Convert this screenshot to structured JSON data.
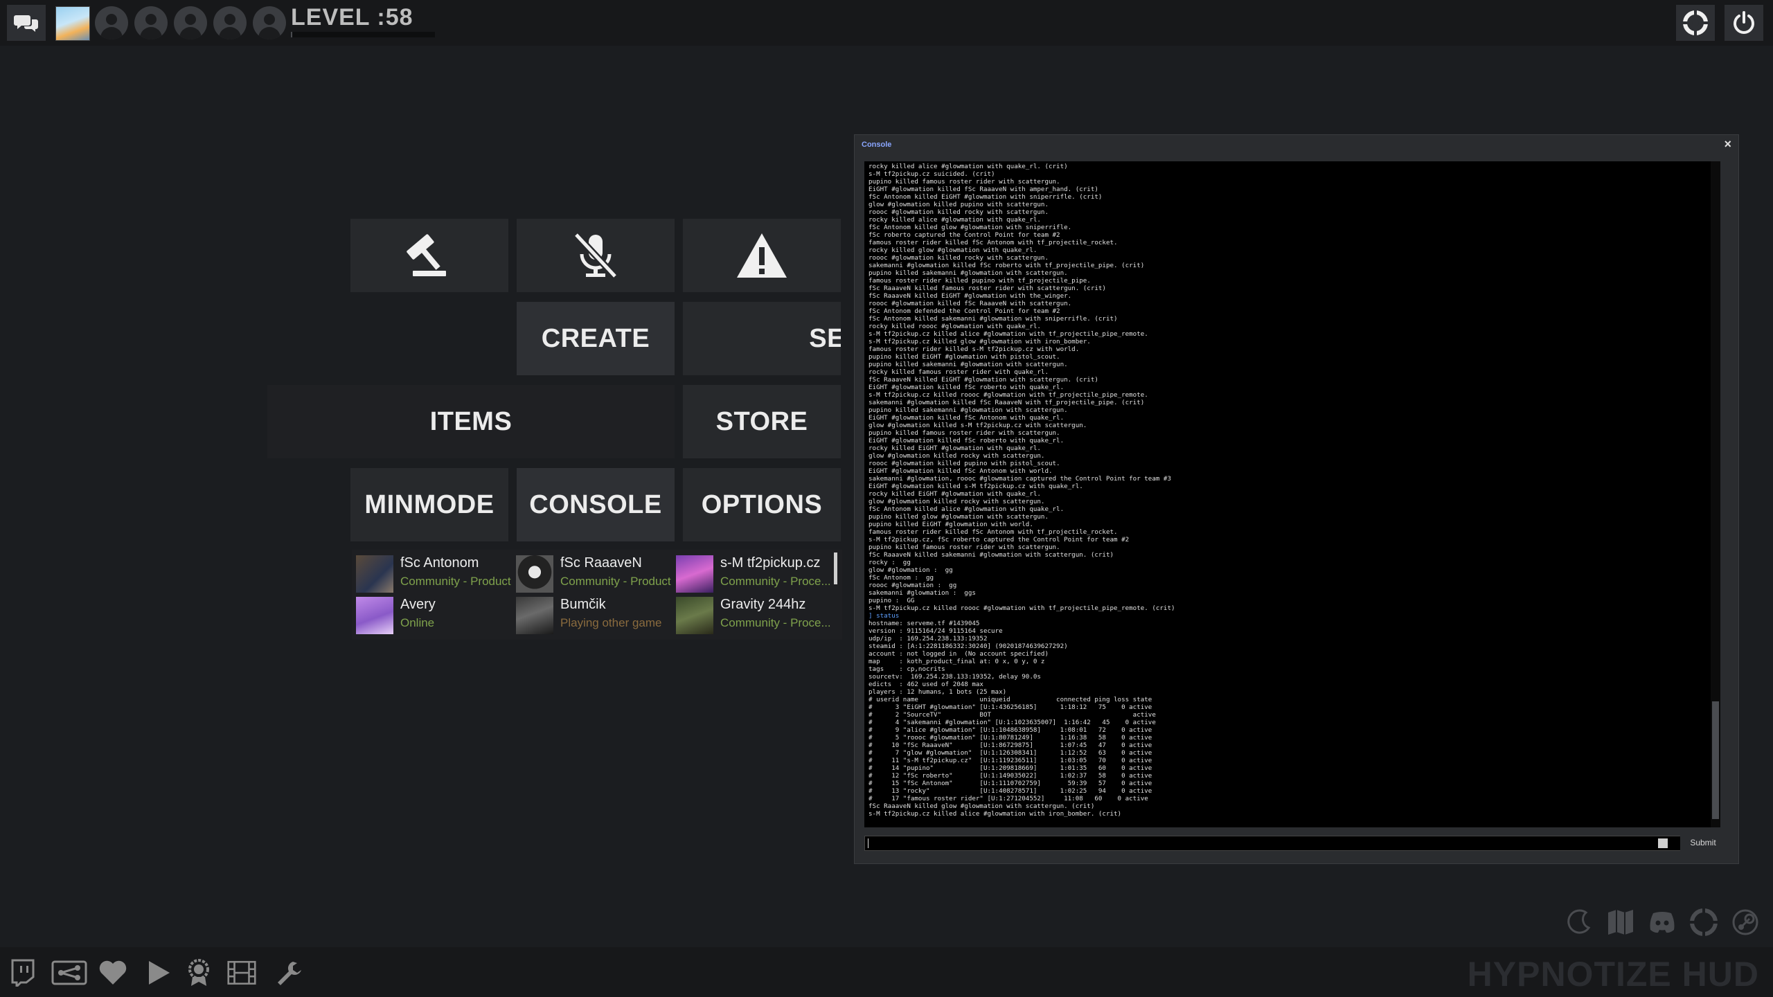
{
  "top_bar": {
    "level_label": "LEVEL :58",
    "level_progress": 0.01,
    "party_slot_count": 5
  },
  "menu": {
    "create_label": "CREATE",
    "server_partial_label": "SE",
    "items_label": "ITEMS",
    "store_label": "STORE",
    "minmode_label": "MINMODE",
    "console_label": "CONSOLE",
    "options_label": "OPTIONS"
  },
  "friends": [
    {
      "name": "fSc Antonom",
      "status": "Community - Product",
      "status_type": "game"
    },
    {
      "name": "fSc RaaaveN",
      "status": "Community - Product",
      "status_type": "game"
    },
    {
      "name": "s-M tf2pickup.cz",
      "status": "Community - Proce...",
      "status_type": "game"
    },
    {
      "name": "Avery",
      "status": "Online",
      "status_type": "online"
    },
    {
      "name": "Bumčik",
      "status": "Playing other game",
      "status_type": "other"
    },
    {
      "name": "Gravity 244hz",
      "status": "Community - Proce...",
      "status_type": "game"
    }
  ],
  "console": {
    "title": "Console",
    "close_glyph": "×",
    "submit_label": "Submit",
    "input_value": "",
    "lines": [
      "rocky killed alice #glowmation with quake_rl. (crit)",
      "s-M tf2pickup.cz suicided. (crit)",
      "pupino killed famous roster rider with scattergun.",
      "EiGHT #glowmation killed fSc RaaaveN with amper_hand. (crit)",
      "fSc Antonom killed EiGHT #glowmation with sniperrifle. (crit)",
      "glow #glowmation killed pupino with scattergun.",
      "roooc #glowmation killed rocky with scattergun.",
      "rocky killed alice #glowmation with quake_rl.",
      "fSc Antonom killed glow #glowmation with sniperrifle.",
      "fSc roberto captured the Control Point for team #2",
      "famous roster rider killed fSc Antonom with tf_projectile_rocket.",
      "rocky killed glow #glowmation with quake_rl.",
      "roooc #glowmation killed rocky with scattergun.",
      "sakemanni #glowmation killed fSc roberto with tf_projectile_pipe. (crit)",
      "pupino killed sakemanni #glowmation with scattergun.",
      "famous roster rider killed pupino with tf_projectile_pipe.",
      "fSc RaaaveN killed famous roster rider with scattergun. (crit)",
      "fSc RaaaveN killed EiGHT #glowmation with the_winger.",
      "roooc #glowmation killed fSc RaaaveN with scattergun.",
      "fSc Antonom defended the Control Point for team #2",
      "fSc Antonom killed sakemanni #glowmation with sniperrifle. (crit)",
      "rocky killed roooc #glowmation with quake_rl.",
      "s-M tf2pickup.cz killed alice #glowmation with tf_projectile_pipe_remote.",
      "s-M tf2pickup.cz killed glow #glowmation with iron_bomber.",
      "famous roster rider killed s-M tf2pickup.cz with world.",
      "pupino killed EiGHT #glowmation with pistol_scout.",
      "pupino killed sakemanni #glowmation with scattergun.",
      "rocky killed famous roster rider with quake_rl.",
      "fSc RaaaveN killed EiGHT #glowmation with scattergun. (crit)",
      "EiGHT #glowmation killed fSc roberto with quake_rl.",
      "s-M tf2pickup.cz killed roooc #glowmation with tf_projectile_pipe_remote.",
      "sakemanni #glowmation killed fSc RaaaveN with tf_projectile_pipe. (crit)",
      "pupino killed sakemanni #glowmation with scattergun.",
      "EiGHT #glowmation killed fSc Antonom with quake_rl.",
      "glow #glowmation killed s-M tf2pickup.cz with scattergun.",
      "pupino killed famous roster rider with scattergun.",
      "EiGHT #glowmation killed fSc roberto with quake_rl.",
      "rocky killed EiGHT #glowmation with quake_rl.",
      "glow #glowmation killed rocky with scattergun.",
      "roooc #glowmation killed pupino with pistol_scout.",
      "EiGHT #glowmation killed fSc Antonom with world.",
      "sakemanni #glowmation, roooc #glowmation captured the Control Point for team #3",
      "EiGHT #glowmation killed s-M tf2pickup.cz with quake_rl.",
      "rocky killed EiGHT #glowmation with quake_rl.",
      "glow #glowmation killed rocky with scattergun.",
      "fSc Antonom killed alice #glowmation with quake_rl.",
      "pupino killed glow #glowmation with scattergun.",
      "pupino killed EiGHT #glowmation with world.",
      "famous roster rider killed fSc Antonom with tf_projectile_rocket.",
      "s-M tf2pickup.cz, fSc roberto captured the Control Point for team #2",
      "pupino killed famous roster rider with scattergun.",
      "fSc RaaaveN killed sakemanni #glowmation with scattergun. (crit)",
      "rocky :  gg",
      "glow #glowmation :  gg",
      "fSc Antonom :  gg",
      "roooc #glowmation :  gg",
      "sakemanni #glowmation :  ggs",
      "pupino :  GG",
      "s-M tf2pickup.cz killed roooc #glowmation with tf_projectile_pipe_remote. (crit)",
      "] status",
      "hostname: serveme.tf #1439045",
      "version : 9115164/24 9115164 secure",
      "udp/ip  : 169.254.238.133:19352",
      "steamid : [A:1:2281186332:30240] (90201874639627292)",
      "account : not logged in  (No account specified)",
      "map     : koth_product_final at: 0 x, 0 y, 0 z",
      "tags    : cp,nocrits",
      "sourcetv:  169.254.238.133:19352, delay 90.0s",
      "edicts  : 462 used of 2048 max",
      "players : 12 humans, 1 bots (25 max)",
      "# userid name                uniqueid            connected ping loss state",
      "#      3 \"EiGHT #glowmation\" [U:1:436256185]      1:18:12   75    0 active",
      "#      2 \"SourceTV\"          BOT                                     active",
      "#      4 \"sakemanni #glowmation\" [U:1:1023635007]  1:16:42   45    0 active",
      "#      9 \"alice #glowmation\" [U:1:1048638958]     1:08:01   72    0 active",
      "#      5 \"roooc #glowmation\" [U:1:80781249]       1:16:38   58    0 active",
      "#     10 \"fSc RaaaveN\"       [U:1:86729875]       1:07:45   47    0 active",
      "#      7 \"glow #glowmation\"  [U:1:126308341]      1:12:52   63    0 active",
      "#     11 \"s-M tf2pickup.cz\"  [U:1:119236511]      1:03:05   70    0 active",
      "#     14 \"pupino\"            [U:1:209818669]      1:01:35   60    0 active",
      "#     12 \"fSc roberto\"       [U:1:149035022]      1:02:37   58    0 active",
      "#     15 \"fSc Antonom\"       [U:1:1110702759]       59:39   57    0 active",
      "#     13 \"rocky\"             [U:1:408278571]      1:02:25   94    0 active",
      "#     17 \"famous roster rider\" [U:1:271204552]     11:08   60    0 active",
      "fSc RaaaveN killed glow #glowmation with scattergun. (crit)",
      "s-M tf2pickup.cz killed alice #glowmation with iron_bomber. (crit)"
    ]
  },
  "bottom_bar": {
    "brand": "HYPNOTIZE HUD"
  },
  "colors": {
    "background": "#1b1d20",
    "tile": "#27292c",
    "friend_online": "#7fa24c",
    "friend_other_game": "#8a6b3e",
    "console_title": "#8aa6ff",
    "console_command": "#5fa0ff"
  },
  "icons": {
    "top_left": [
      "chat-icon",
      "player-avatar",
      "party-slot-icon"
    ],
    "top_right": [
      "settings-lifebuoy-icon",
      "power-icon"
    ],
    "menu": [
      "gavel-icon",
      "mic-off-icon",
      "warning-icon"
    ],
    "bottom_left": [
      "twitch-icon",
      "server-browser-icon",
      "favorites-icon",
      "play-icon",
      "achievements-icon",
      "replays-icon",
      "workshop-icon"
    ],
    "bottom_right": [
      "moon-icon",
      "guide-icon",
      "discord-icon",
      "tf2-logo-icon",
      "steam-icon"
    ]
  }
}
